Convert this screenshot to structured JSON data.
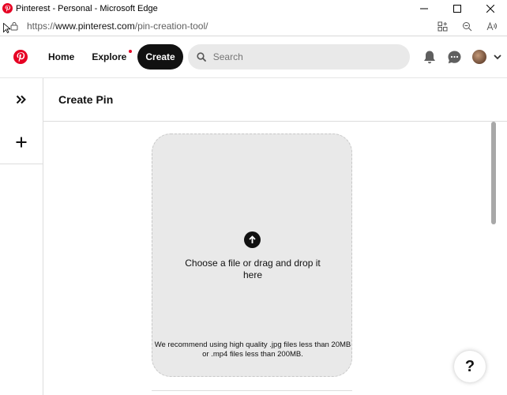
{
  "window": {
    "title": "Pinterest - Personal - Microsoft Edge"
  },
  "addressbar": {
    "url_scheme": "https://",
    "url_host": "www.pinterest.com",
    "url_path": "/pin-creation-tool/"
  },
  "header": {
    "home_label": "Home",
    "explore_label": "Explore",
    "create_label": "Create",
    "search_placeholder": "Search"
  },
  "page": {
    "title": "Create Pin"
  },
  "dropzone": {
    "choose_text": "Choose a file or drag and drop it here",
    "recommend_line1": "We recommend using high quality .jpg files less than 20MB",
    "recommend_line2": "or .mp4 files less than 200MB."
  },
  "help": {
    "label": "?"
  },
  "colors": {
    "brand": "#e60023",
    "create_bg": "#111111",
    "dropzone_bg": "#e9e9e9",
    "search_bg": "#e9e9e9"
  }
}
